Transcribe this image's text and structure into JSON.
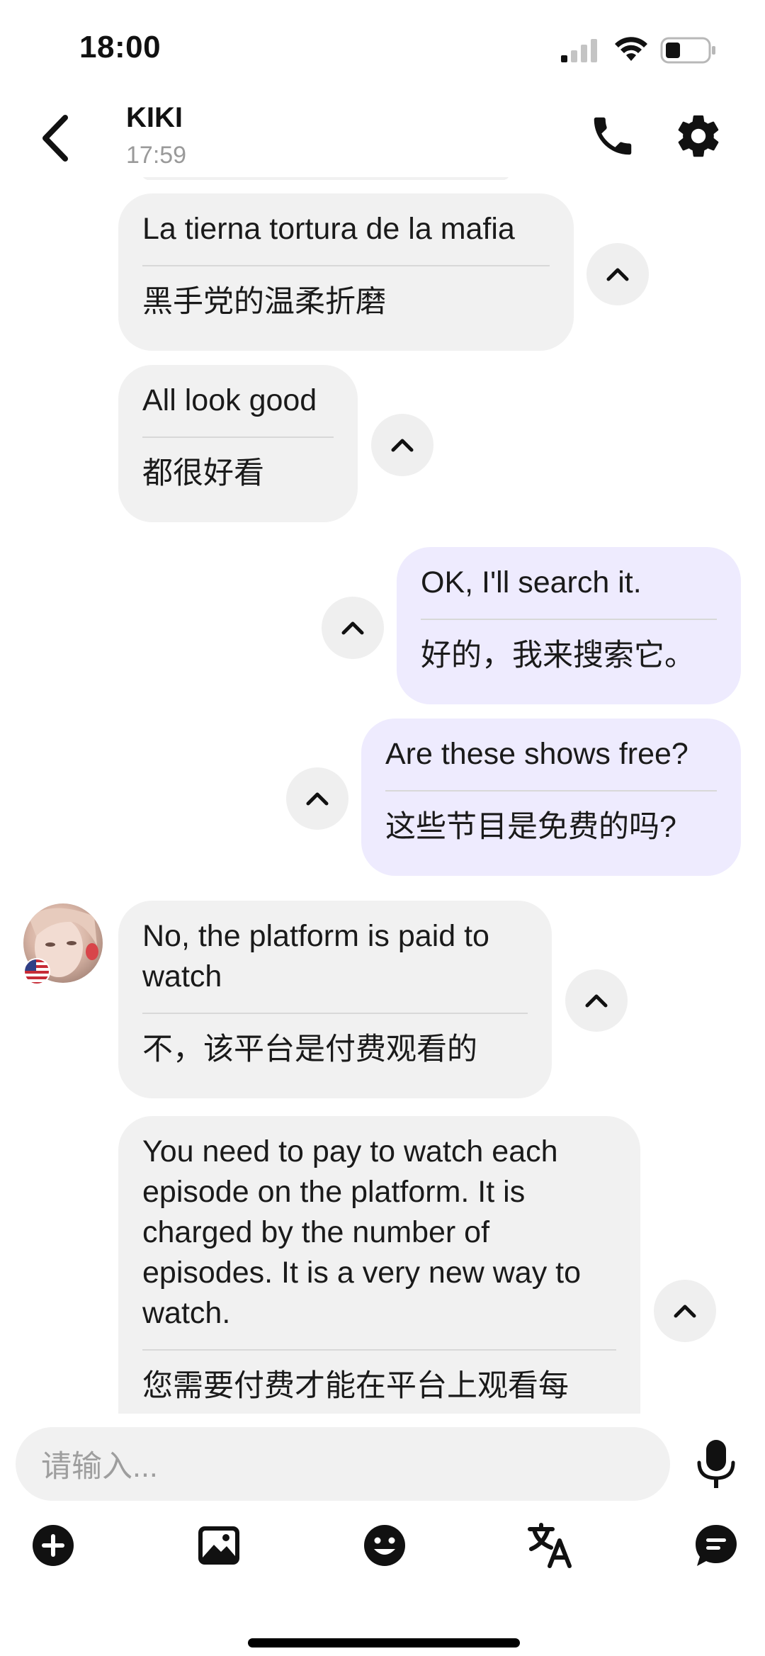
{
  "status_bar": {
    "time": "18:00"
  },
  "header": {
    "contact_name": "KIKI",
    "last_seen": "17:59"
  },
  "messages": [
    {
      "side": "them",
      "original": "La tierna tortura de la mafia",
      "translation": "黑手党的温柔折磨"
    },
    {
      "side": "them",
      "original": "All look good",
      "translation": "都很好看"
    },
    {
      "side": "me",
      "original": "OK, I'll search it.",
      "translation": "好的，我来搜索它。"
    },
    {
      "side": "me",
      "original": "Are these shows free?",
      "translation": "这些节目是免费的吗?"
    },
    {
      "side": "them",
      "original": "No, the platform is paid to watch",
      "translation": "不，该平台是付费观看的"
    },
    {
      "side": "them",
      "original": "You need to pay to watch each episode on the platform. It is charged by the number of episodes. It is a very new way to watch.",
      "translation": "您需要付费才能在平台上观看每"
    }
  ],
  "composer": {
    "placeholder": "请输入..."
  },
  "icons": {
    "back": "chevron-left-icon",
    "call": "phone-icon",
    "settings": "gear-icon",
    "collapse": "chevron-up-icon",
    "mic": "microphone-icon",
    "add": "plus-circle-icon",
    "image": "image-icon",
    "emoji": "emoji-icon",
    "translate": "translate-icon",
    "chat": "chat-bubble-icon"
  },
  "colors": {
    "incoming_bubble": "#f1f1f1",
    "outgoing_bubble": "#eeebfe",
    "muted_text": "#9a9a9a"
  }
}
